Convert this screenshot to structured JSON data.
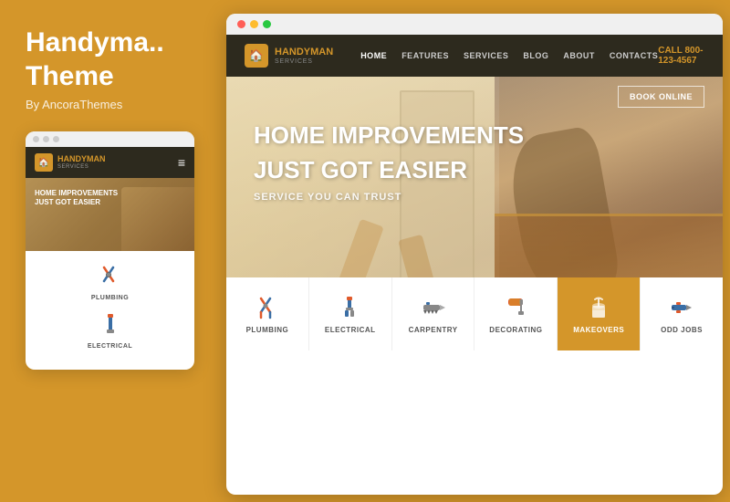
{
  "left": {
    "title_line1": "Handyma..",
    "title_line2": "Theme",
    "by": "By AncoraThemes"
  },
  "mobile": {
    "logo": {
      "handy": "HANDY",
      "man": "MAN",
      "services": "SERVICES"
    },
    "hero": {
      "line1": "HOME IMPROVEMENTS",
      "line2": "JUST GOT EASIER"
    },
    "services": [
      {
        "label": "PLUMBING"
      },
      {
        "label": "ELECTRICAL"
      }
    ]
  },
  "desktop": {
    "logo": {
      "handy": "HANDY",
      "man": "MAN",
      "services": "SERVICES"
    },
    "nav": {
      "links": [
        "HOME",
        "FEATURES",
        "SERVICES",
        "BLOG",
        "ABOUT",
        "CONTACTS"
      ],
      "call_label": "CALL",
      "call_number": "800-123-4567"
    },
    "hero": {
      "headline_line1": "HOME IMPROVEMENTS",
      "headline_line2": "JUST GOT EASIER",
      "subline": "SERVICE YOU CAN TRUST",
      "book_btn": "BOOK ONLINE"
    },
    "services": [
      {
        "label": "PLUMBING"
      },
      {
        "label": "ELECTRICAL"
      },
      {
        "label": "CARPENTRY"
      },
      {
        "label": "DECORATING"
      },
      {
        "label": "MAKEOVERS"
      },
      {
        "label": "ODD JOBS"
      }
    ]
  }
}
